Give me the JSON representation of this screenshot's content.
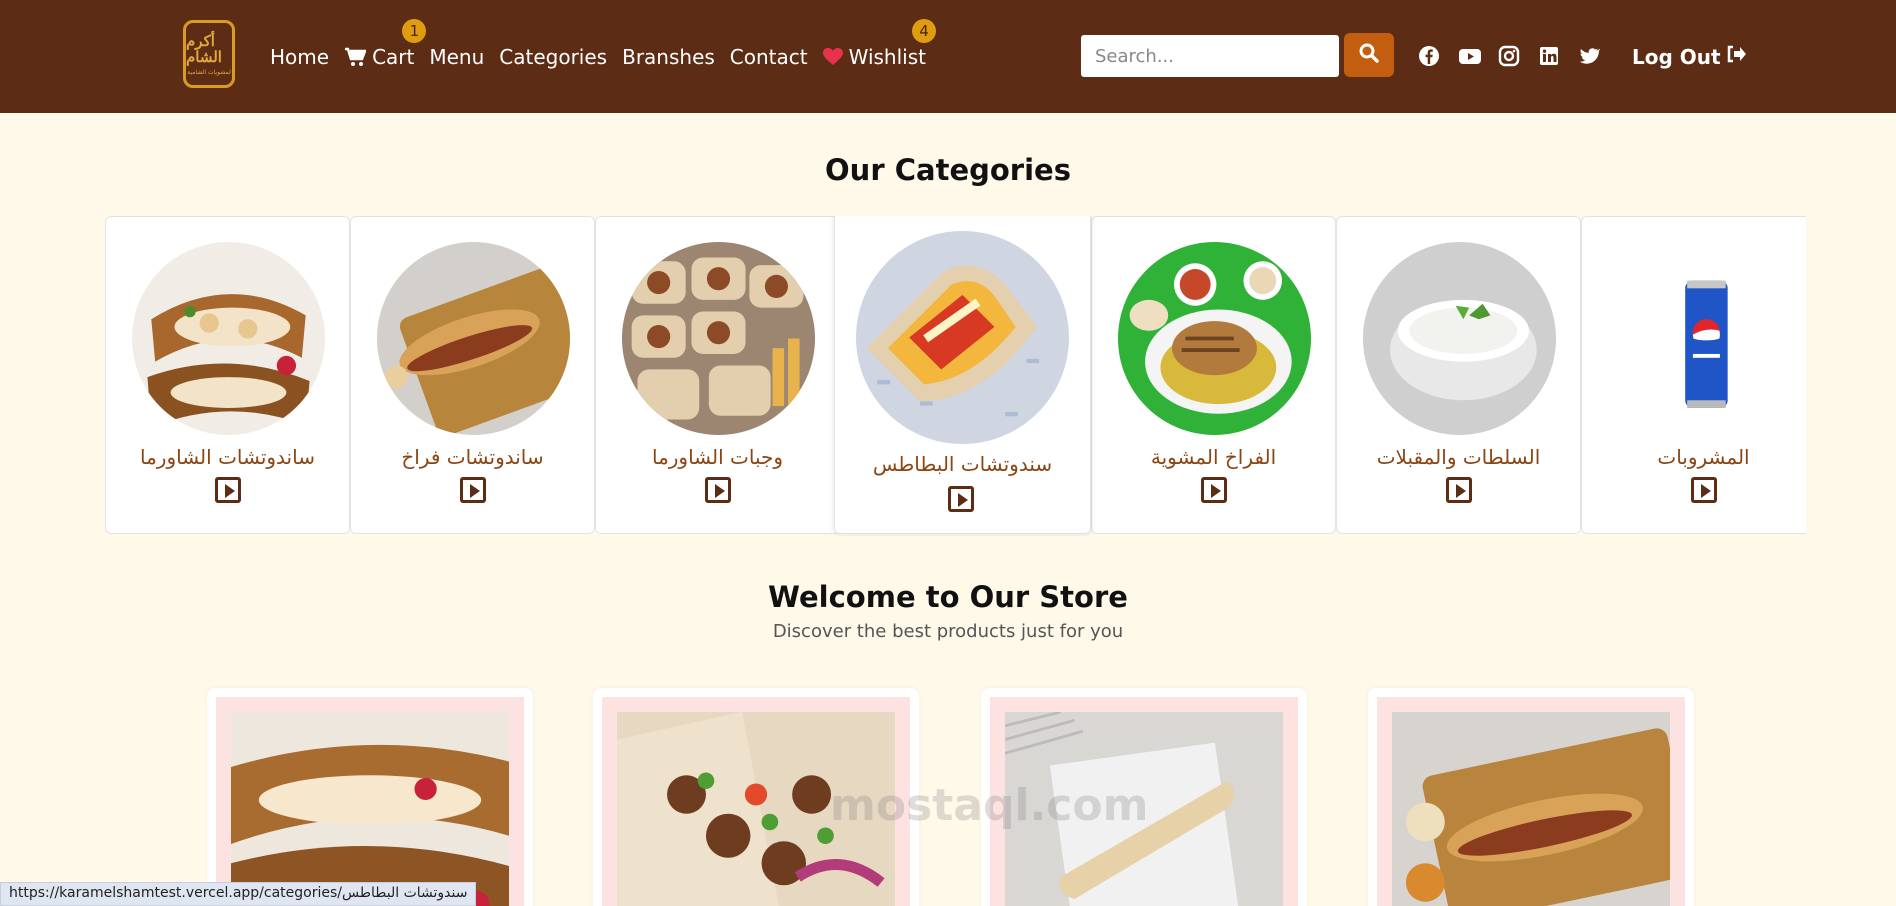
{
  "nav": {
    "logo_text_line1": "أكرم الشام",
    "logo_text_line2": "لمشويات الشامية",
    "home": "Home",
    "cart": "Cart",
    "cart_count": "1",
    "menu": "Menu",
    "categories": "Categories",
    "branches": "Branshes",
    "contact": "Contact",
    "wishlist": "Wishlist",
    "wishlist_count": "4",
    "search_placeholder": "Search...",
    "logout": "Log Out",
    "socials": [
      "facebook-icon",
      "youtube-icon",
      "instagram-icon",
      "linkedin-icon",
      "twitter-icon"
    ]
  },
  "categories": {
    "title": "Our Categories",
    "items": [
      {
        "name": "ساندوتشات الشاورما"
      },
      {
        "name": "ساندوتشات فراخ"
      },
      {
        "name": "وجبات الشاورما"
      },
      {
        "name": "سندوتشات البطاطس"
      },
      {
        "name": "الفراخ المشوية"
      },
      {
        "name": "السلطات والمقبلات"
      },
      {
        "name": "المشروبات"
      }
    ]
  },
  "welcome": {
    "title": "Welcome to Our Store",
    "subtitle": "Discover the best products just for you"
  },
  "status_url": "https://karamelshamtest.vercel.app/categories/سندوتشات البطاطس",
  "watermark": "mostaql.com",
  "colors": {
    "navbar": "#5d2c14",
    "accent": "#c35d10",
    "badge": "#e09c11",
    "background": "#fff9ea",
    "category_text": "#8b4513"
  }
}
